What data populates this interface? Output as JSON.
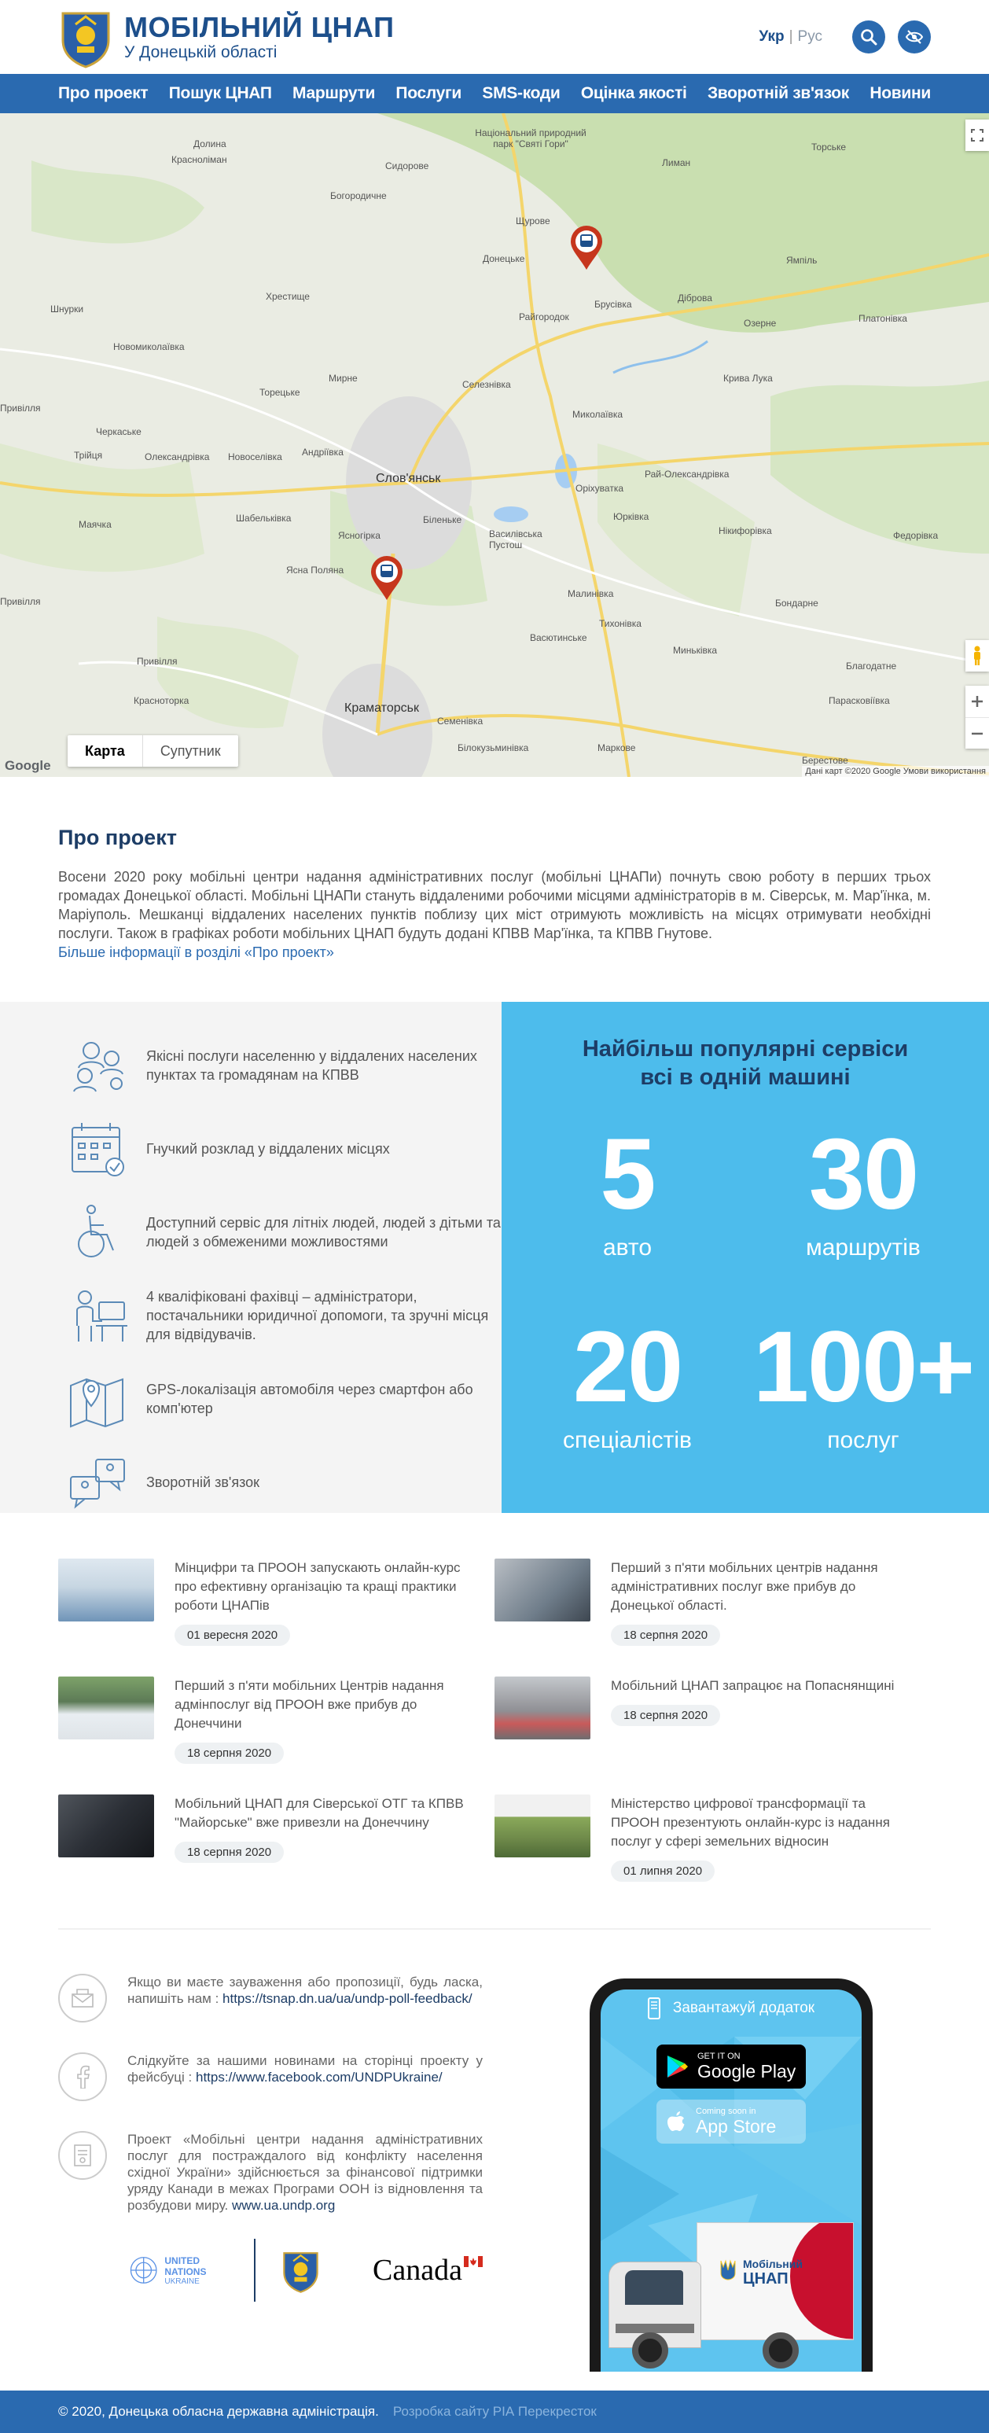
{
  "header": {
    "title": "МОБІЛЬНИЙ ЦНАП",
    "subtitle": "У Донецькій області",
    "lang_active": "Укр",
    "lang_separator": "|",
    "lang_other": "Рус",
    "search_icon": "search-icon",
    "accessibility_icon": "eye-crossed-icon"
  },
  "nav": {
    "items": [
      "Про проект",
      "Пошук ЦНАП",
      "Маршрути",
      "Послуги",
      "SMS-коди",
      "Оцінка якості",
      "Зворотній зв'язок",
      "Новини"
    ]
  },
  "map": {
    "cities": [
      "Слов'янськ",
      "Краматорськ"
    ],
    "labels": [
      "Долина",
      "Красноліман",
      "Сидорове",
      "Богородичне",
      "Національний природний парк \"Святі Гори\"",
      "Лиман",
      "Торське",
      "Щурове",
      "Донецьке",
      "Ямпіль",
      "Хрестище",
      "Райгородок",
      "Брусівка",
      "Діброва",
      "Озерне",
      "Платонівка",
      "Шнурки",
      "Новомиколаївка",
      "Мирне",
      "Торецьке",
      "Селезнівка",
      "Крива Лука",
      "Привілля",
      "Черкаське",
      "Андріївка",
      "Миколаївка",
      "Трійця",
      "Новоселівка",
      "Олександрівка",
      "Оріхуватка",
      "Рай-Олександрівка",
      "Шабельківка",
      "Ясногірка",
      "Біленьке",
      "Юрківка",
      "Нікифорівка",
      "Маячка",
      "Василівська Пустош",
      "Ясна Поляна",
      "Малинівка",
      "Федорівка",
      "Привілля",
      "Тихонівка",
      "Васютинське",
      "Миньківка",
      "Бондарне",
      "Благодатне",
      "Красноторка",
      "Семенівка",
      "Парасковіївка",
      "Білокузьминівка",
      "Маркове",
      "Берестове",
      "Привілля"
    ],
    "toggle_map": "Карта",
    "toggle_satellite": "Супутник",
    "google": "Google",
    "attribution": "Дані карт ©2020 Google   Умови використання"
  },
  "about": {
    "title": "Про проект",
    "text": "Восени 2020 року мобільні центри надання адміністративних послуг (мобільні ЦНАПи) почнуть свою роботу в перших трьох громадах Донецької області. Мобільні ЦНАПи стануть віддаленими робочими місцями адміністраторів в м. Сіверськ, м. Мар'їнка, м. Маріуполь. Мешканці віддалених населених пунктів поблизу цих міст отримують можливість на місцях отримувати необхідні послуги. Також в графіках роботи мобільних ЦНАП будуть додані КПВВ Мар'їнка, та КПВВ Гнутове.",
    "link": "Більше інформації в розділі «Про проект»"
  },
  "features": {
    "items": [
      {
        "icon": "people-group-icon",
        "text": "Якісні послуги населенню у віддалених населених пунктах та громадянам на КПВВ"
      },
      {
        "icon": "calendar-check-icon",
        "text": "Гнучкий розклад у віддалених місцях"
      },
      {
        "icon": "wheelchair-icon",
        "text": "Доступний сервіс для літніх людей, людей з дітьми та людей з обмеженими можливостями"
      },
      {
        "icon": "office-worker-icon",
        "text": "4 кваліфіковані фахівці – адміністратори, постачальники юридичної допомоги, та зручні місця для відвідувачів."
      },
      {
        "icon": "map-pin-icon",
        "text": "GPS-локалізація автомобіля через смартфон або комп'ютер"
      },
      {
        "icon": "chat-bubbles-icon",
        "text": "Зворотній зв'язок"
      }
    ],
    "heading_line1": "Найбільш популярні сервіси",
    "heading_line2": "всі в одній машині",
    "stats": [
      {
        "number": "5",
        "label": "авто"
      },
      {
        "number": "30",
        "label": "маршрутів"
      },
      {
        "number": "20",
        "label": "спеціалістів"
      },
      {
        "number": "100+",
        "label": "послуг"
      }
    ]
  },
  "news": [
    {
      "title": "Мінцифри та ПРООН запускають онлайн-курс про ефективну організацію та кращі практики роботи ЦНАПів",
      "date": "01 вересня 2020",
      "thumb_color": "#9ab7cf"
    },
    {
      "title": "Перший з п'яти мобільних центрів надання адміністративних послуг вже прибув до Донецької області.",
      "date": "18 серпня 2020",
      "thumb_color": "#6f7d8a"
    },
    {
      "title": "Перший з п'яти мобільних Центрів надання адмінпослуг від ПРООН вже прибув до Донеччини",
      "date": "18 серпня 2020",
      "thumb_color": "#5c7a56"
    },
    {
      "title": "Мобільний ЦНАП запрацює на Попаснянщині",
      "date": "18 серпня 2020",
      "thumb_color": "#8f8f94"
    },
    {
      "title": "Мобільний ЦНАП для Сіверської ОТГ та КПВВ \"Майорське\" вже привезли на Донеччину",
      "date": "18 серпня 2020",
      "thumb_color": "#2b2f36"
    },
    {
      "title": "Міністерство цифрової трансформації та ПРООН презентують онлайн-курс із надання послуг у сфері земельних відносин",
      "date": "01 липня 2020",
      "thumb_color": "#6f8a4a"
    }
  ],
  "contact": {
    "items": [
      {
        "icon": "envelope-icon",
        "text": "Якщо ви маєте зауваження або пропозиції, будь ласка, напишіть нам : ",
        "link": "https://tsnap.dn.ua/ua/undp-poll-feedback/"
      },
      {
        "icon": "facebook-icon",
        "text": "Слідкуйте за нашими новинами на сторінці проекту у фейсбуці : ",
        "link": "https://www.facebook.com/UNDPUkraine/"
      },
      {
        "icon": "document-icon",
        "text": "Проект «Мобільні центри надання адміністративних послуг для постраждалого від конфлікту населення східної України» здійснюється за фінансової підтримки уряду Канади в межах Програми ООН із відновлення та розбудови миру. ",
        "link": "www.ua.undp.org"
      }
    ],
    "partners": {
      "un_line1": "UNITED NATIONS",
      "un_line2": "UKRAINE",
      "canada": "Canada"
    }
  },
  "app": {
    "download_label": "Завантажуй додаток",
    "google_small": "GET IT ON",
    "google_big": "Google Play",
    "apple_small": "Coming soon in",
    "apple_big": "App Store",
    "truck_brand_line1": "Мобільний",
    "truck_brand_line2": "ЦНАП"
  },
  "footer": {
    "copyright": "© 2020, Донецька обласна державна адміністрація.",
    "developer": "Розробка сайту РІА Перекресток"
  },
  "colors": {
    "primary": "#2a6ab0",
    "dark": "#1d3d66",
    "light_blue": "#4dbcec",
    "marker": "#c6361d"
  }
}
